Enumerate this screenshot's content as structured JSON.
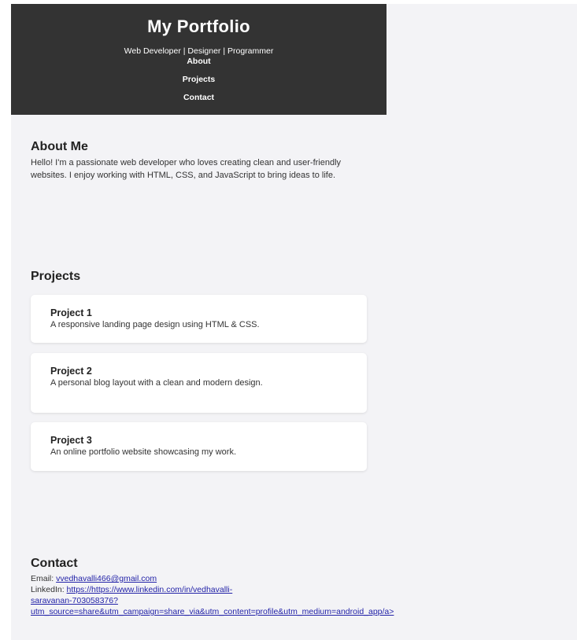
{
  "header": {
    "title": "My Portfolio",
    "tagline": "Web Developer | Designer | Programmer",
    "nav": [
      "About",
      "Projects",
      "Contact"
    ]
  },
  "about": {
    "title": "About Me",
    "text": "Hello! I'm a passionate web developer who loves creating clean and user-friendly websites. I enjoy working with HTML, CSS, and JavaScript to bring ideas to life."
  },
  "projects": {
    "title": "Projects",
    "items": [
      {
        "name": "Project 1",
        "description": "A responsive landing page design using HTML & CSS."
      },
      {
        "name": "Project 2",
        "description": "A personal blog layout with a clean and modern design."
      },
      {
        "name": "Project 3",
        "description": "An online portfolio website showcasing my work."
      }
    ]
  },
  "contact": {
    "title": "Contact",
    "email_label": "Email:",
    "email": "vvedhavalli466@gmail.com",
    "linkedin_label": "LinkedIn:",
    "linkedin_lines": [
      "https://https://www.linkedin.com/in/vedhavalli-",
      "saravanan-703058376?",
      "utm_source=share&utm_campaign=share_via&utm_content=profile&utm_medium=android_app/a>"
    ]
  },
  "colors": {
    "header_bg": "#333333",
    "page_bg": "#f3f3f6",
    "link": "#2323a8"
  }
}
